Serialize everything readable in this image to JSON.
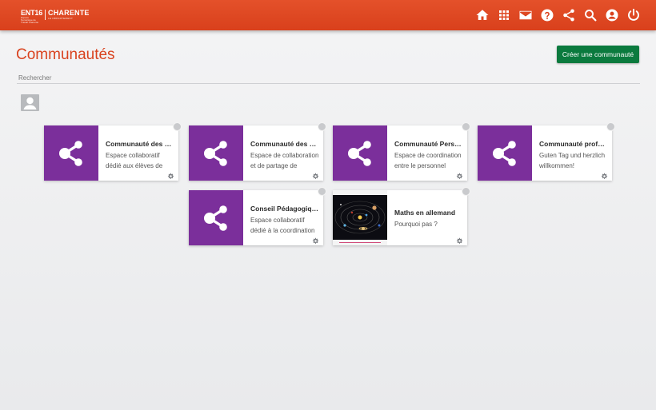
{
  "header": {
    "logo": {
      "ent": "ENT16",
      "ent_sub": "Espace Numérique de Travail Charente",
      "region": "CHARENTE",
      "region_sub": "LE DÉPARTEMENT"
    },
    "nav_icons": [
      "home-icon",
      "apps-icon",
      "mail-icon",
      "help-icon",
      "share-icon",
      "search-icon",
      "account-icon",
      "power-icon"
    ]
  },
  "page": {
    "title": "Communautés",
    "create_button": "Créer une communauté",
    "search_placeholder": "Rechercher"
  },
  "theme": {
    "header_color": "#d9401c",
    "title_color": "#d9431f",
    "button_color": "#0b7a3e",
    "thumb_color": "#7b2f9b"
  },
  "communities": [
    {
      "title": "Communauté des 5è...",
      "desc1": "Espace collaboratif",
      "desc2": "dédié aux élèves de"
    },
    {
      "title": "Communauté des Pr...",
      "desc1": "Espace de collaboration",
      "desc2": "et de partage de"
    },
    {
      "title": "Communauté Person...",
      "desc1": "Espace de coordination",
      "desc2": "entre le personnel"
    },
    {
      "title": "Communauté profes...",
      "desc1": "Guten Tag und herzlich",
      "desc2": "willkommen!"
    },
    {
      "title": "Conseil Pédagogiqu...",
      "desc1": "Espace collaboratif",
      "desc2": "dédié à la coordination"
    },
    {
      "title": "Maths en allemand",
      "desc1": "Pourquoi pas ?",
      "desc2": ""
    }
  ]
}
